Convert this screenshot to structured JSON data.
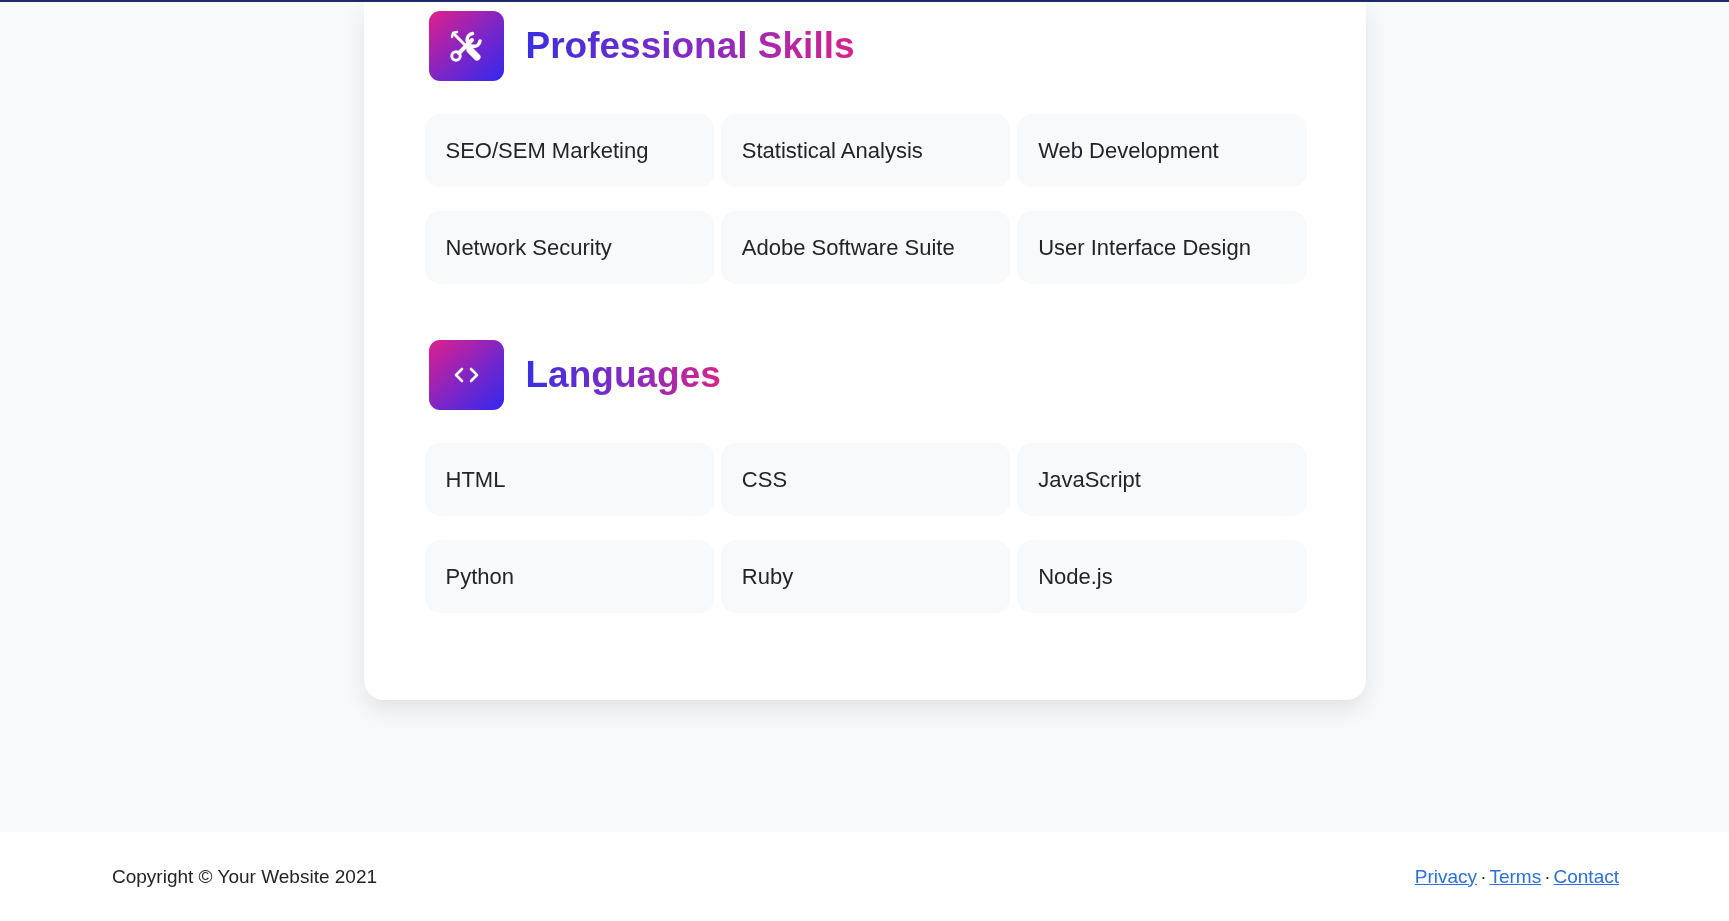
{
  "sections": [
    {
      "kind": "skills",
      "title": "Professional Skills",
      "items": [
        "SEO/SEM Marketing",
        "Statistical Analysis",
        "Web Development",
        "Network Security",
        "Adobe Software Suite",
        "User Interface Design"
      ]
    },
    {
      "kind": "languages",
      "title": "Languages",
      "items": [
        "HTML",
        "CSS",
        "JavaScript",
        "Python",
        "Ruby",
        "Node.js"
      ]
    }
  ],
  "footer": {
    "copyright": "Copyright © Your Website 2021",
    "items": [
      {
        "kind": "link",
        "text": "Privacy"
      },
      {
        "kind": "separator",
        "text": "·"
      },
      {
        "kind": "link",
        "text": "Terms"
      },
      {
        "kind": "separator",
        "text": "·"
      },
      {
        "kind": "link",
        "text": "Contact"
      }
    ]
  }
}
